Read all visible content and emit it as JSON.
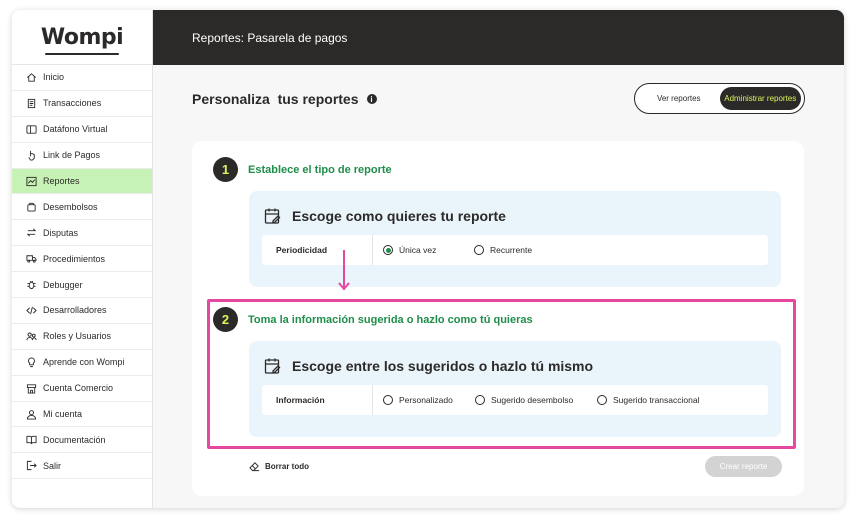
{
  "app": {
    "logo_text": "Wompi",
    "header_title": "Reportes: Pasarela de pagos"
  },
  "sidebar": {
    "items": [
      {
        "label": "Inicio",
        "icon": "home-icon"
      },
      {
        "label": "Transacciones",
        "icon": "receipt-icon"
      },
      {
        "label": "Datáfono Virtual",
        "icon": "terminal-icon"
      },
      {
        "label": "Link de Pagos",
        "icon": "link-hand-icon"
      },
      {
        "label": "Reportes",
        "icon": "chart-icon",
        "active": true
      },
      {
        "label": "Desembolsos",
        "icon": "bag-icon"
      },
      {
        "label": "Disputas",
        "icon": "swap-icon"
      },
      {
        "label": "Procedimientos",
        "icon": "truck-icon"
      },
      {
        "label": "Debugger",
        "icon": "bug-icon"
      },
      {
        "label": "Desarrolladores",
        "icon": "code-icon"
      },
      {
        "label": "Roles y Usuarios",
        "icon": "users-icon"
      },
      {
        "label": "Aprende con Wompi",
        "icon": "bulb-icon"
      },
      {
        "label": "Cuenta Comercio",
        "icon": "store-icon"
      },
      {
        "label": "Mi cuenta",
        "icon": "user-icon"
      },
      {
        "label": "Documentación",
        "icon": "book-icon"
      },
      {
        "label": "Salir",
        "icon": "logout-icon"
      }
    ]
  },
  "main": {
    "page_title": "Personaliza  tus reportes",
    "toggle": {
      "option_1": "Ver reportes",
      "option_2": "Administrar reportes",
      "active": "option_2"
    },
    "step1": {
      "number": "1",
      "title": "Establece el tipo de reporte",
      "panel_title": "Escoge como quieres tu reporte",
      "row_label": "Periodicidad",
      "options": [
        {
          "label": "Única vez",
          "selected": true
        },
        {
          "label": "Recurrente",
          "selected": false
        }
      ]
    },
    "step2": {
      "number": "2",
      "title": "Toma la información sugerida o hazlo como tú quieras",
      "panel_title": "Escoge entre los sugeridos o hazlo tú mismo",
      "row_label": "Información",
      "options": [
        {
          "label": "Personalizado",
          "selected": false
        },
        {
          "label": "Sugerido desembolso",
          "selected": false
        },
        {
          "label": "Sugerido transaccional",
          "selected": false
        }
      ]
    },
    "clear_label": "Borrar todo",
    "create_label": "Crear reporte"
  },
  "colors": {
    "header_bg": "#2c2a29",
    "accent_green": "#1f8e4a",
    "active_nav": "#c7f2b5",
    "lime": "#dff25c",
    "highlight_pink": "#e6479f",
    "panel_blue": "#eaf4fb"
  }
}
